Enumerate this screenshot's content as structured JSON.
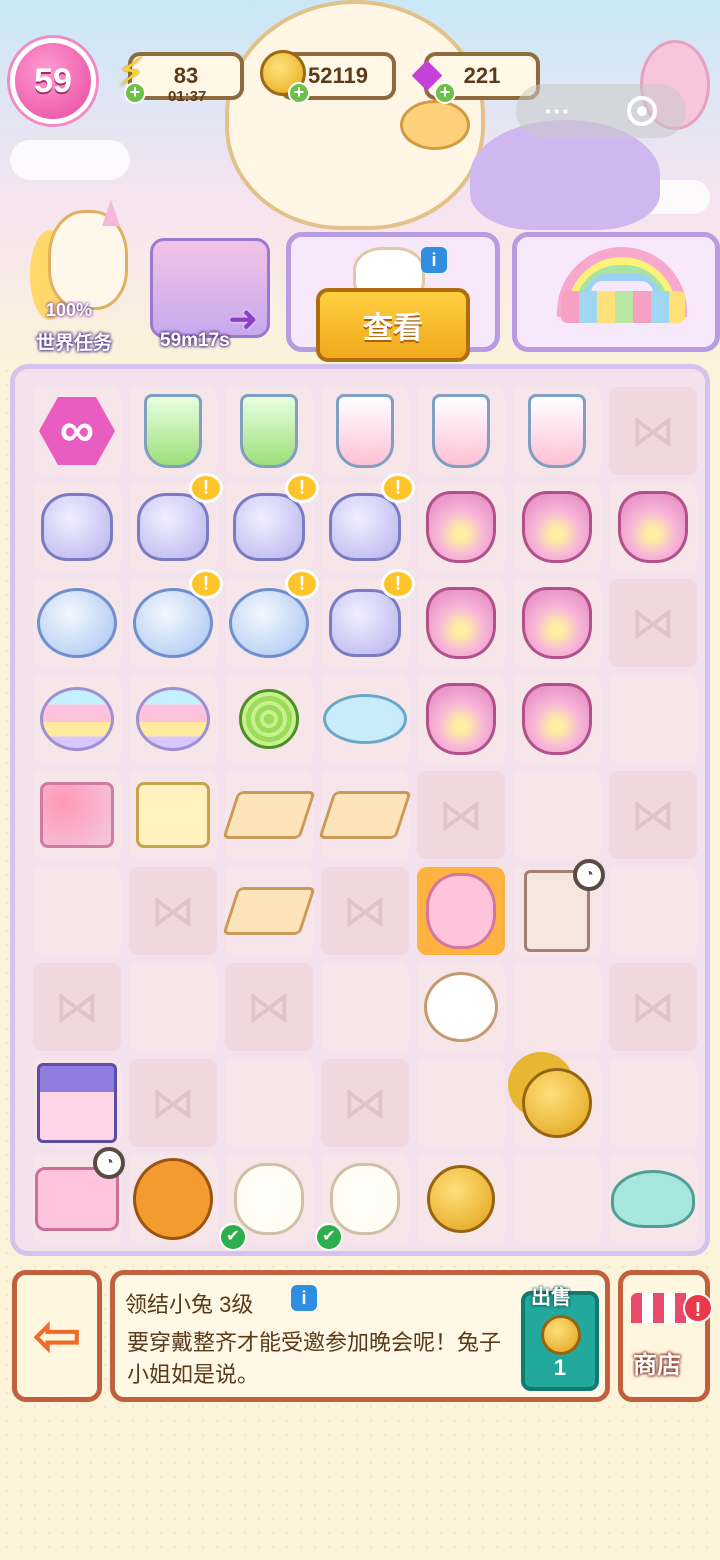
{
  "hud": {
    "level": "59",
    "energy": "83",
    "energy_timer": "01:37",
    "coins": "52119",
    "gems": "221",
    "plus": "+"
  },
  "capsule": {
    "more": "···"
  },
  "quests": {
    "progress": "100%",
    "world_task_label": "世界任务",
    "event_timer": "59m17s",
    "view_button": "查看",
    "info": "i"
  },
  "board": {
    "rows": 9,
    "cols": 7,
    "badges": {
      "exclaim": "!",
      "check": "✔",
      "clock": "◔"
    },
    "infinity": "∞"
  },
  "item_panel": {
    "title": "领结小兔 3级",
    "info": "i",
    "description": "要穿戴整齐才能受邀参加晚会呢！兔子小姐如是说。",
    "sell_label": "出售",
    "sell_value": "1"
  },
  "shop": {
    "label": "商店",
    "alert": "!"
  },
  "colors": {
    "accent_pink": "#e7489f",
    "board_border": "#d6c2ee",
    "panel_border": "#c1603f",
    "button_yellow": "#ffd040",
    "sell_teal": "#23a99b"
  }
}
